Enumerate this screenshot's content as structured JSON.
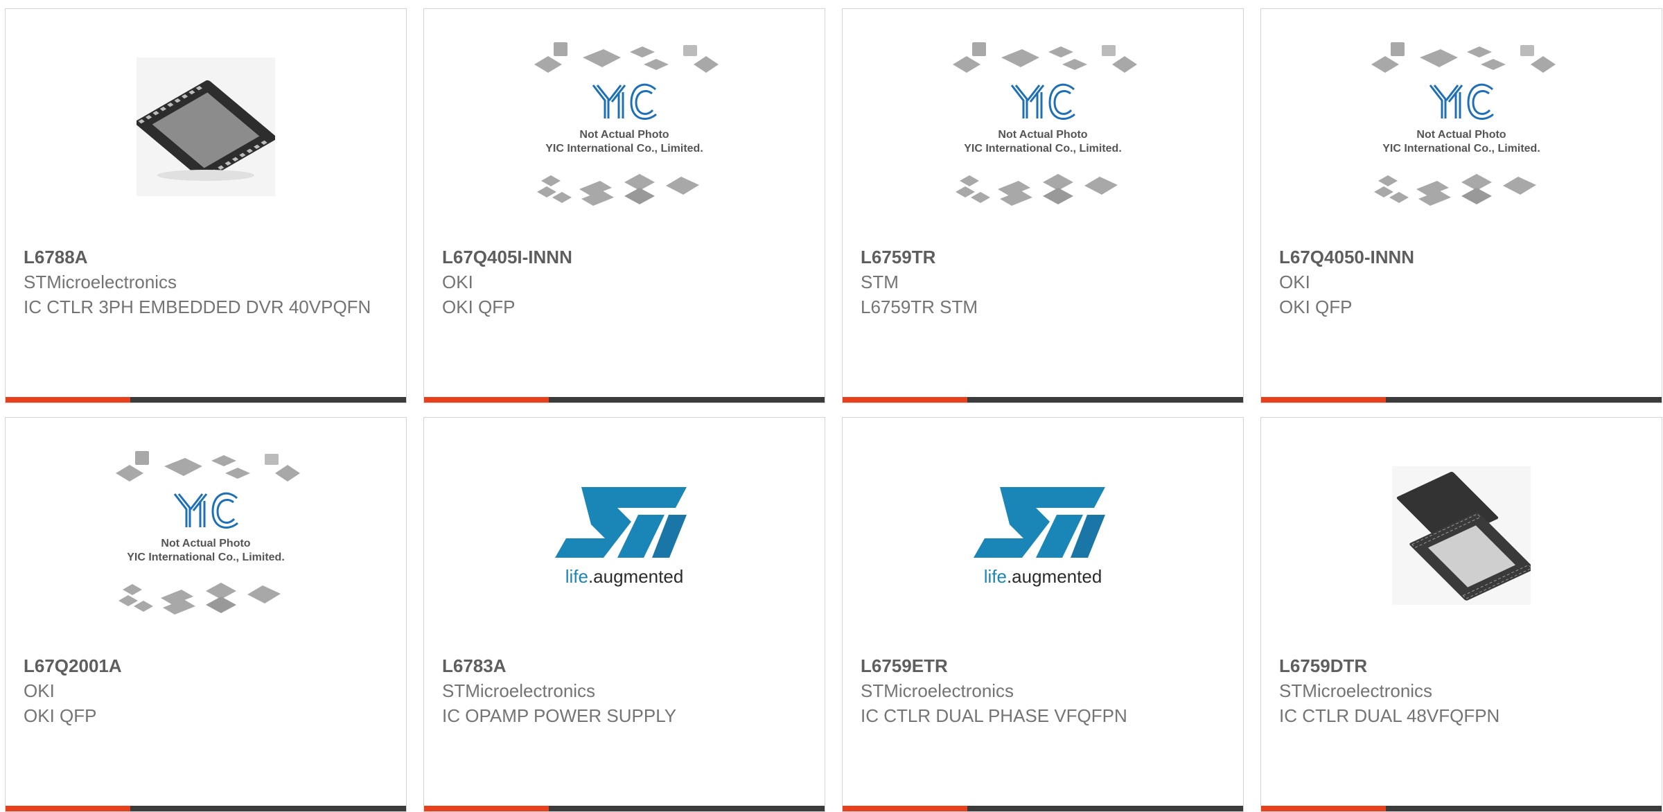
{
  "colors": {
    "accent": "#e8401c",
    "bar": "#3b3b3b",
    "st_blue": "#1a86b8",
    "yic_blue": "#1d6fb8"
  },
  "placeholder": {
    "line1": "Not Actual Photo",
    "line2": "YIC International Co., Limited.",
    "logo": "YIC"
  },
  "st_logo": {
    "tagline_a": "life",
    "tagline_b": ".augmented"
  },
  "products": [
    {
      "part": "L6788A",
      "manufacturer": "STMicroelectronics",
      "description": "IC CTLR 3PH EMBEDDED DVR 40VPQFN",
      "image": "qfn-chip-icon"
    },
    {
      "part": "L67Q405I-INNN",
      "manufacturer": "OKI",
      "description": "OKI QFP",
      "image": "yic-placeholder"
    },
    {
      "part": "L6759TR",
      "manufacturer": "STM",
      "description": "L6759TR STM",
      "image": "yic-placeholder"
    },
    {
      "part": "L67Q4050-INNN",
      "manufacturer": "OKI",
      "description": "OKI QFP",
      "image": "yic-placeholder"
    },
    {
      "part": "L67Q2001A",
      "manufacturer": "OKI",
      "description": "OKI QFP",
      "image": "yic-placeholder"
    },
    {
      "part": "L6783A",
      "manufacturer": "STMicroelectronics",
      "description": "IC OPAMP POWER SUPPLY",
      "image": "st-logo"
    },
    {
      "part": "L6759ETR",
      "manufacturer": "STMicroelectronics",
      "description": "IC CTLR DUAL PHASE VFQFPN",
      "image": "st-logo"
    },
    {
      "part": "L6759DTR",
      "manufacturer": "STMicroelectronics",
      "description": "IC CTLR DUAL 48VFQFPN",
      "image": "qfn-chip-pair-icon"
    }
  ]
}
